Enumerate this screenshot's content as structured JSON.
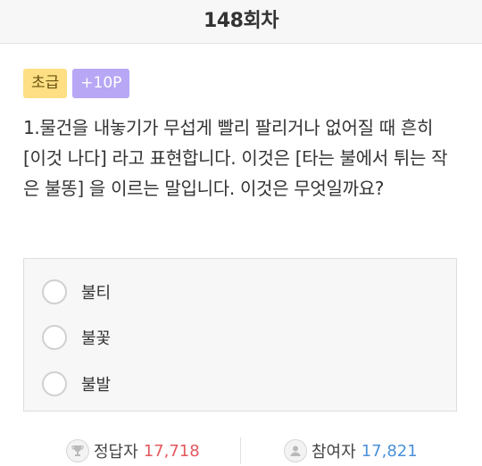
{
  "header": {
    "title": "148회차"
  },
  "badges": {
    "level": "초급",
    "points": "+10P"
  },
  "question": {
    "text": "1.물건을 내놓기가 무섭게 빨리 팔리거나 없어질 때 흔히 [이것 나다] 라고 표현합니다. 이것은 [타는 불에서 튀는 작은 불똥] 을 이르는 말입니다. 이것은 무엇일까요?"
  },
  "options": [
    {
      "label": "불티"
    },
    {
      "label": "불꽃"
    },
    {
      "label": "불발"
    }
  ],
  "stats": {
    "correct_label": "정답자",
    "correct_count": "17,718",
    "participants_label": "참여자",
    "participants_count": "17,821"
  },
  "colors": {
    "level_badge": "#ffdf84",
    "points_badge": "#b7a7f5",
    "correct_count": "#e2595f",
    "participants_count": "#4a90d9"
  }
}
